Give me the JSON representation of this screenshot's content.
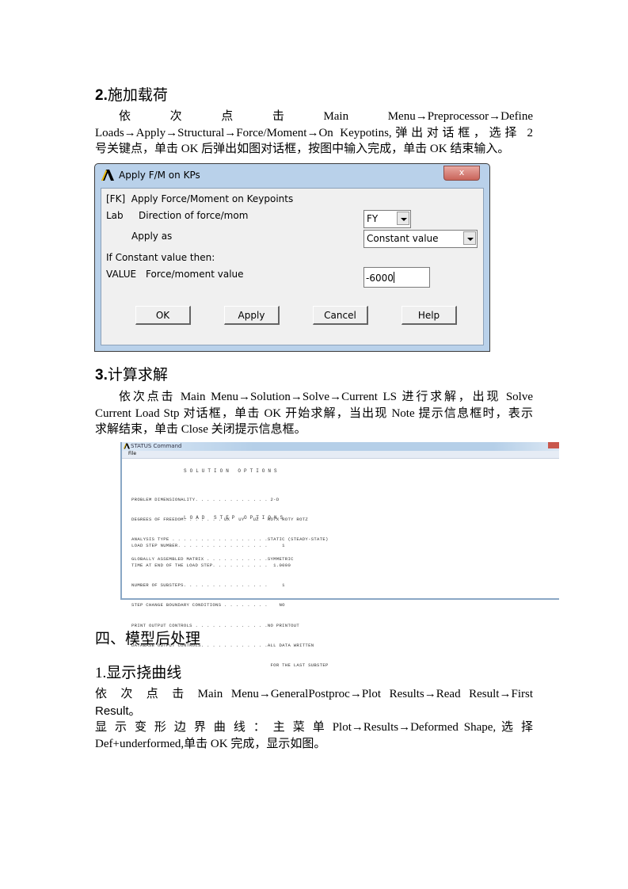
{
  "section2": {
    "number": "2.",
    "title": "施加载荷",
    "para_line1_words": [
      "依",
      "次",
      "点",
      "击",
      "Main",
      "Menu→Preprocessor→Define"
    ],
    "para_line2": "Loads→Apply→Structural→Force/Moment→On Keypotins,弹出对话框，选择 2",
    "para_line3": "号关键点，单击 OK 后弹出如图对话框，按图中输入完成，单击 OK 结束输入。"
  },
  "dialog": {
    "title": "Apply F/M on KPs",
    "close_label": "x",
    "header_line": "[FK]  Apply Force/Moment on Keypoints",
    "lab_label": "Lab",
    "direction_label": "Direction of force/mom",
    "direction_value": "FY",
    "apply_as_label": "Apply as",
    "apply_as_value": "Constant value",
    "if_constant_label": "If Constant value then:",
    "value_label": "VALUE",
    "force_label": "Force/moment value",
    "force_value": "-6000",
    "buttons": {
      "ok": "OK",
      "apply": "Apply",
      "cancel": "Cancel",
      "help": "Help"
    }
  },
  "section3": {
    "number": "3.",
    "title": "计算求解",
    "para_line1": "依次点击 Main Menu→Solution→Solve→Current LS 进行求解，出现 Solve",
    "para_line2": "Current Load Stp  对话框，单击 OK 开始求解，当出现 Note 提示信息框时，表示",
    "para_line3": "求解结束，单击 Close 关闭提示信息框。"
  },
  "status_window": {
    "title": "STATUS Command",
    "menu_item": "File",
    "heading1": "SOLUTION OPTIONS",
    "block1": [
      "PROBLEM DIMENSIONALITY. . . . . . . . . . . . . 2-D",
      "DEGREES OF FREEDOM. . . . . . . UX   UY   UZ   ROTX ROTY ROTZ",
      "ANALYSIS TYPE . . . . . . . . . . . . . . . . .STATIC (STEADY-STATE)",
      "GLOBALLY ASSEMBLED MATRIX . . . . . . . . . . .SYMMETRIC"
    ],
    "heading2": "LOAD STEP OPTIONS",
    "block2": [
      "LOAD STEP NUMBER. . . . . . . . . . . . . . . .     1",
      "TIME AT END OF THE LOAD STEP. . . . . . . . . .  1.0000",
      "NUMBER OF SUBSTEPS. . . . . . . . . . . . . . .     1",
      "STEP CHANGE BOUNDARY CONDITIONS . . . . . . . .    NO",
      "PRINT OUTPUT CONTROLS . . . . . . . . . . . . .NO PRINTOUT",
      "DATABASE OUTPUT CONTROLS. . . . . . . . . . . .ALL DATA WRITTEN",
      "                                                FOR THE LAST SUBSTEP"
    ]
  },
  "section4": {
    "title": "四、模型后处理",
    "sub1_title": "1.显示挠曲线",
    "para1_line1": "依 次 点 击  Main  Menu→GeneralPostproc→Plot  Results→Read  Result→First",
    "para1_line2": "Result。",
    "para2_line1": "显 示 变 形 边 界 曲 线 ： 主 菜 单   Plot→Results→Deformed  Shape, 选 择",
    "para2_line2": "Def+underformed,单击 OK 完成，显示如图。"
  }
}
